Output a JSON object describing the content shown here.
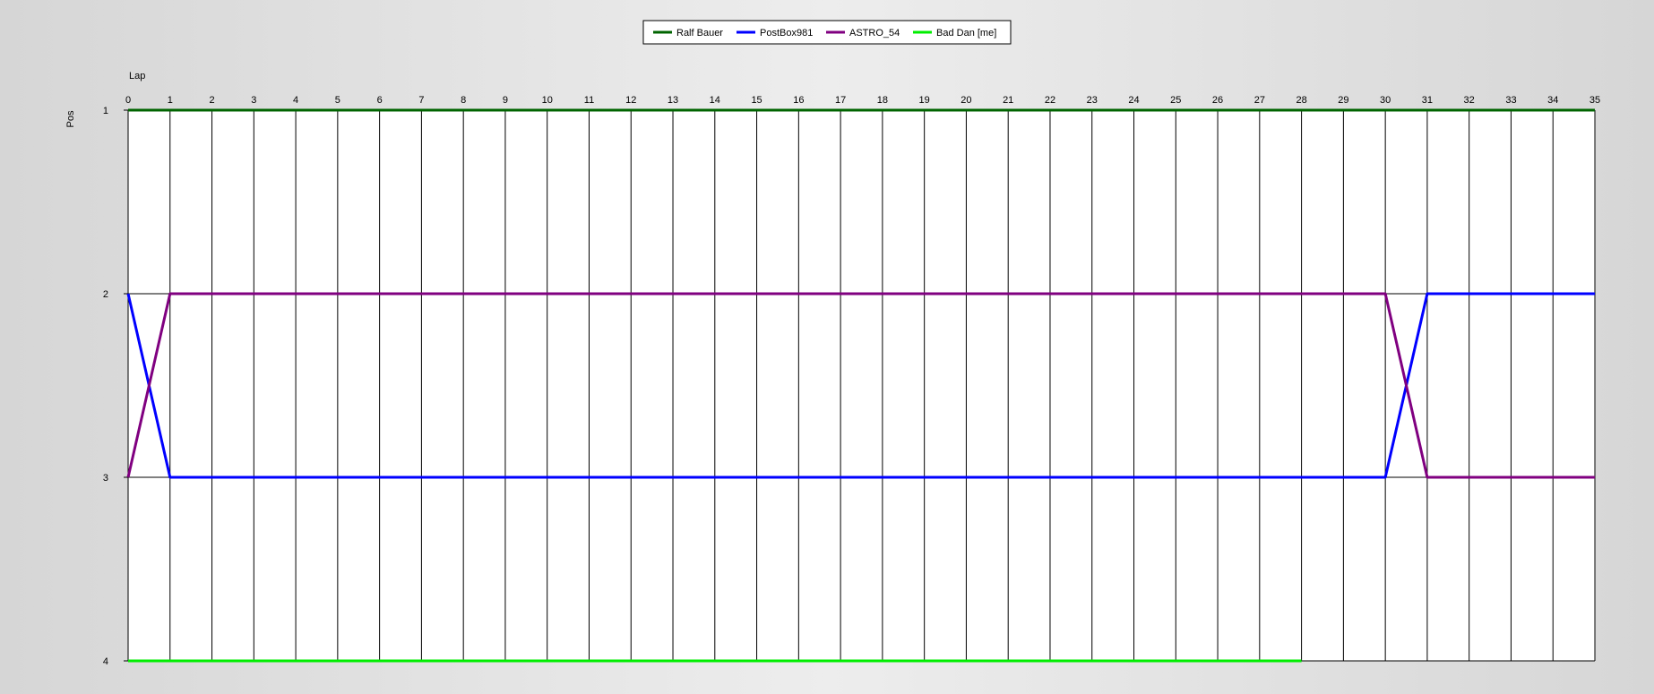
{
  "chart_data": {
    "type": "line",
    "xlabel": "Lap",
    "ylabel": "Pos",
    "x": [
      0,
      1,
      2,
      3,
      4,
      5,
      6,
      7,
      8,
      9,
      10,
      11,
      12,
      13,
      14,
      15,
      16,
      17,
      18,
      19,
      20,
      21,
      22,
      23,
      24,
      25,
      26,
      27,
      28,
      29,
      30,
      31,
      32,
      33,
      34,
      35
    ],
    "xlim": [
      0,
      35
    ],
    "ylim": [
      1,
      4
    ],
    "y_inverted": true,
    "y_ticks": [
      1,
      2,
      3,
      4
    ],
    "grid": "vertical lines at every lap",
    "legend_position": "top-center",
    "series": [
      {
        "name": "Ralf Bauer",
        "color": "#006400",
        "x": [
          0,
          35
        ],
        "y": [
          1,
          1
        ]
      },
      {
        "name": "PostBox981",
        "color": "#0000ff",
        "x": [
          0,
          1,
          30,
          31,
          35
        ],
        "y": [
          2,
          3,
          3,
          2,
          2
        ]
      },
      {
        "name": "ASTRO_54",
        "color": "#800080",
        "x": [
          0,
          1,
          30,
          31,
          35
        ],
        "y": [
          3,
          2,
          2,
          3,
          3
        ]
      },
      {
        "name": "Bad Dan [me]",
        "color": "#00ee00",
        "x": [
          0,
          28
        ],
        "y": [
          4,
          4
        ]
      }
    ]
  }
}
